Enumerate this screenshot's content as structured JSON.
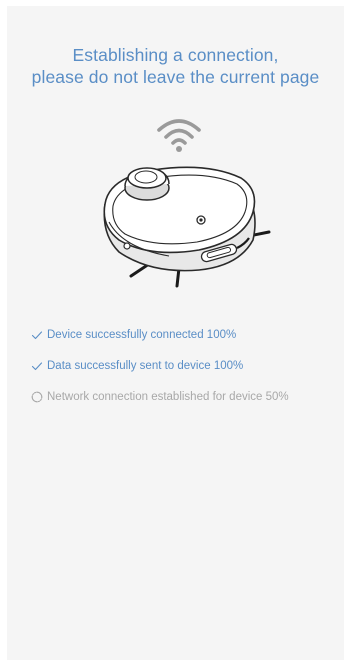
{
  "title": {
    "line1": "Establishing a connection,",
    "line2": "please do not leave the current page"
  },
  "icons": {
    "wifi": "wifi-icon",
    "robot": "robot-vacuum-illustration",
    "check": "check-icon",
    "loading": "loading-spinner-icon"
  },
  "colors": {
    "accent": "#5a8ec6",
    "pending": "#a8a8a8",
    "wifi": "#9a9a9a",
    "background": "#f5f5f5"
  },
  "status_items": [
    {
      "text": "Device successfully connected 100%",
      "state": "done"
    },
    {
      "text": "Data successfully sent to device 100%",
      "state": "done"
    },
    {
      "text": "Network connection established for device 50%",
      "state": "pending"
    }
  ]
}
